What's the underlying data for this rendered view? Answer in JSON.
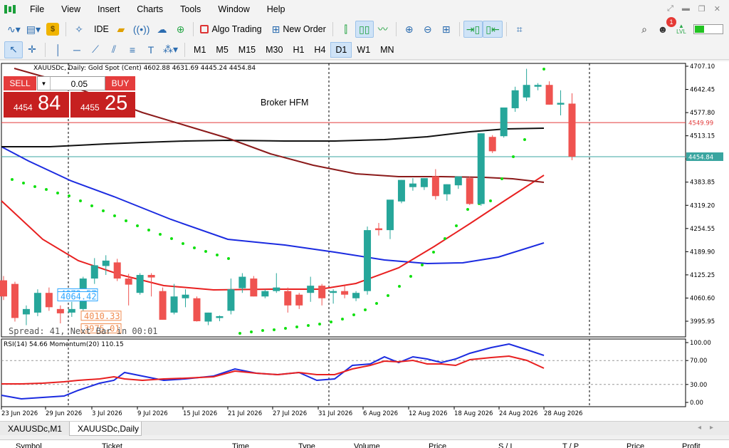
{
  "menu": {
    "items": [
      "File",
      "View",
      "Insert",
      "Charts",
      "Tools",
      "Window",
      "Help"
    ]
  },
  "toolbar": {
    "ide_label": "IDE",
    "algo_trading_label": "Algo Trading",
    "new_order_label": "New Order",
    "notification_count": "1",
    "level_label": "LVL",
    "timeframes": [
      "M1",
      "M5",
      "M15",
      "M30",
      "H1",
      "H4",
      "D1",
      "W1",
      "MN"
    ],
    "active_timeframe": "D1"
  },
  "chart": {
    "title": "XAUUSDc, Daily: Gold Spot (Cent)  4602.88 4631.69 4445.24 4454.84",
    "broker_label": "Broker HFM",
    "spread_text": "Spread: 41, Next Bar in 00:01",
    "rsi_title": "RSI(14) 54.66 Momentum(20) 110.15",
    "bid_label": "4454.84",
    "ask_label": "4549.99",
    "left_labels": [
      "4072.57",
      "4064.42",
      "4010.33",
      "3975.01"
    ]
  },
  "trade_panel": {
    "sell_label": "SELL",
    "buy_label": "BUY",
    "lot": "0.05",
    "sell_price_small": "4454",
    "sell_price_big": "84",
    "buy_price_small": "4455",
    "buy_price_big": "25"
  },
  "chart_data": {
    "type": "candlestick",
    "symbol": "XAUUSDc",
    "timeframe": "Daily",
    "price_axis_ticks": [
      4707.1,
      4642.45,
      4577.8,
      4513.15,
      4448.5,
      4383.85,
      4319.2,
      4254.55,
      4189.9,
      4125.25,
      4060.6,
      3995.95
    ],
    "rsi_axis_ticks": [
      100.0,
      70.0,
      30.0,
      0.0
    ],
    "date_ticks": [
      "23 Jun 2026",
      "29 Jun 2026",
      "3 Jul 2026",
      "9 Jul 2026",
      "15 Jul 2026",
      "21 Jul 2026",
      "27 Jul 2026",
      "31 Jul 2026",
      "6 Aug 2026",
      "12 Aug 2026",
      "18 Aug 2026",
      "24 Aug 2026",
      "28 Aug 2026"
    ],
    "candles": [
      {
        "o": 4110,
        "h": 4122,
        "l": 4055,
        "c": 4065
      },
      {
        "o": 4100,
        "h": 4106,
        "l": 3995,
        "c": 4005
      },
      {
        "o": 4015,
        "h": 4040,
        "l": 3985,
        "c": 4030
      },
      {
        "o": 4020,
        "h": 4085,
        "l": 4010,
        "c": 4075
      },
      {
        "o": 4075,
        "h": 4090,
        "l": 4025,
        "c": 4035
      },
      {
        "o": 4030,
        "h": 4040,
        "l": 3990,
        "c": 4018
      },
      {
        "o": 4020,
        "h": 4050,
        "l": 4008,
        "c": 4030
      },
      {
        "o": 4030,
        "h": 4120,
        "l": 4025,
        "c": 4115
      },
      {
        "o": 4115,
        "h": 4172,
        "l": 4100,
        "c": 4152
      },
      {
        "o": 4150,
        "h": 4180,
        "l": 4125,
        "c": 4165
      },
      {
        "o": 4160,
        "h": 4170,
        "l": 4108,
        "c": 4115
      },
      {
        "o": 4115,
        "h": 4128,
        "l": 4040,
        "c": 4098
      },
      {
        "o": 4075,
        "h": 4130,
        "l": 4070,
        "c": 4125
      },
      {
        "o": 4125,
        "h": 4130,
        "l": 4065,
        "c": 4118
      },
      {
        "o": 4080,
        "h": 4090,
        "l": 4000,
        "c": 4000
      },
      {
        "o": 4020,
        "h": 4100,
        "l": 4015,
        "c": 4065
      },
      {
        "o": 4060,
        "h": 4085,
        "l": 4035,
        "c": 4070
      },
      {
        "o": 4060,
        "h": 4065,
        "l": 3995,
        "c": 3996
      },
      {
        "o": 3995,
        "h": 4020,
        "l": 3985,
        "c": 4020
      },
      {
        "o": 4005,
        "h": 4012,
        "l": 3996,
        "c": 4010
      },
      {
        "o": 4025,
        "h": 4115,
        "l": 4015,
        "c": 4085
      },
      {
        "o": 4088,
        "h": 4130,
        "l": 4075,
        "c": 4120
      },
      {
        "o": 4115,
        "h": 4122,
        "l": 4065,
        "c": 4065
      },
      {
        "o": 4065,
        "h": 4085,
        "l": 4060,
        "c": 4080
      },
      {
        "o": 4080,
        "h": 4130,
        "l": 4075,
        "c": 4090
      },
      {
        "o": 4080,
        "h": 4090,
        "l": 4020,
        "c": 4040
      },
      {
        "o": 4070,
        "h": 4075,
        "l": 4030,
        "c": 4040
      },
      {
        "o": 4075,
        "h": 4120,
        "l": 4050,
        "c": 4095
      },
      {
        "o": 4095,
        "h": 4100,
        "l": 4040,
        "c": 4060
      },
      {
        "o": 4075,
        "h": 4085,
        "l": 4045,
        "c": 4080
      },
      {
        "o": 4080,
        "h": 4095,
        "l": 4060,
        "c": 4070
      },
      {
        "o": 4060,
        "h": 4080,
        "l": 4052,
        "c": 4075
      },
      {
        "o": 4080,
        "h": 4260,
        "l": 4070,
        "c": 4250
      },
      {
        "o": 4255,
        "h": 4270,
        "l": 4235,
        "c": 4250
      },
      {
        "o": 4250,
        "h": 4330,
        "l": 4225,
        "c": 4335
      },
      {
        "o": 4330,
        "h": 4390,
        "l": 4325,
        "c": 4390
      },
      {
        "o": 4370,
        "h": 4395,
        "l": 4360,
        "c": 4380
      },
      {
        "o": 4370,
        "h": 4395,
        "l": 4362,
        "c": 4395
      },
      {
        "o": 4400,
        "h": 4420,
        "l": 4335,
        "c": 4345
      },
      {
        "o": 4350,
        "h": 4378,
        "l": 4332,
        "c": 4378
      },
      {
        "o": 4375,
        "h": 4400,
        "l": 4365,
        "c": 4400
      },
      {
        "o": 4395,
        "h": 4400,
        "l": 4320,
        "c": 4323
      },
      {
        "o": 4323,
        "h": 4520,
        "l": 4318,
        "c": 4520
      },
      {
        "o": 4510,
        "h": 4515,
        "l": 4465,
        "c": 4470
      },
      {
        "o": 4512,
        "h": 4590,
        "l": 4508,
        "c": 4592
      },
      {
        "o": 4590,
        "h": 4650,
        "l": 4580,
        "c": 4640
      },
      {
        "o": 4620,
        "h": 4700,
        "l": 4610,
        "c": 4655
      },
      {
        "o": 4650,
        "h": 4660,
        "l": 4640,
        "c": 4655
      },
      {
        "o": 4655,
        "h": 4665,
        "l": 4600,
        "c": 4600
      },
      {
        "o": 4600,
        "h": 4640,
        "l": 4570,
        "c": 4605
      },
      {
        "o": 4602.88,
        "h": 4631.69,
        "l": 4445.24,
        "c": 4454.84
      }
    ]
  }
}
